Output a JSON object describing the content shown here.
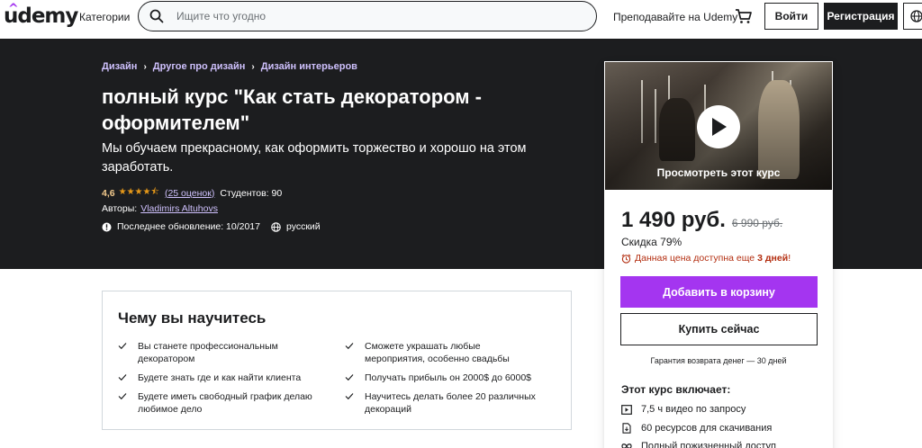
{
  "header": {
    "logo": "udemy",
    "categories": "Категории",
    "search_placeholder": "Ищите что угодно",
    "teach": "Преподавайте на Udemy",
    "login": "Войти",
    "signup": "Регистрация"
  },
  "hero": {
    "breadcrumbs": [
      "Дизайн",
      "Другое про дизайн",
      "Дизайн интерьеров"
    ],
    "title": "полный курс \"Как стать декоратором - оформителем\"",
    "subtitle": "Мы обучаем прекрасному, как оформить торжество и хорошо на этом заработать.",
    "rating": "4,6",
    "rating_value": 4.6,
    "stars": "★★★★⯪",
    "reviews": "(25 оценок)",
    "students": "Студентов: 90",
    "authors_label": "Авторы:",
    "author": "Vladimirs Altuhovs",
    "last_update": "Последнее обновление: 10/2017",
    "language": "русский"
  },
  "card": {
    "preview_label": "Просмотреть этот курс",
    "price": "1 490 руб.",
    "old_price": "6 990 руб.",
    "discount": "Скидка 79%",
    "deadline_text": "Данная цена доступна еще",
    "deadline_bold": "3 дней",
    "deadline_end": "!",
    "add_to_cart": "Добавить в корзину",
    "buy_now": "Купить сейчас",
    "guarantee": "Гарантия возврата денег — 30 дней",
    "includes_title": "Этот курс включает:",
    "includes": [
      {
        "icon": "video-icon",
        "text": "7,5 ч видео по запросу"
      },
      {
        "icon": "file-icon",
        "text": "60 ресурсов для скачивания"
      },
      {
        "icon": "infinity-icon",
        "text": "Полный пожизненный доступ"
      }
    ]
  },
  "learn": {
    "title": "Чему вы научитесь",
    "items": [
      "Вы станете профессиональным декоратором",
      "Сможете украшать любые мероприятия, особенно свадьбы",
      "Будете знать где и как найти клиента",
      "Получать прибыль он 2000$ до 6000$",
      "Будете иметь свободный график делаю любимое дело",
      "Научитесь делать более 20 различных декораций"
    ]
  },
  "colors": {
    "brand": "#a435f0",
    "dark": "#1c1d1f",
    "link_light": "#cec0fc",
    "star": "#e59819",
    "alert": "#b32d0f"
  }
}
